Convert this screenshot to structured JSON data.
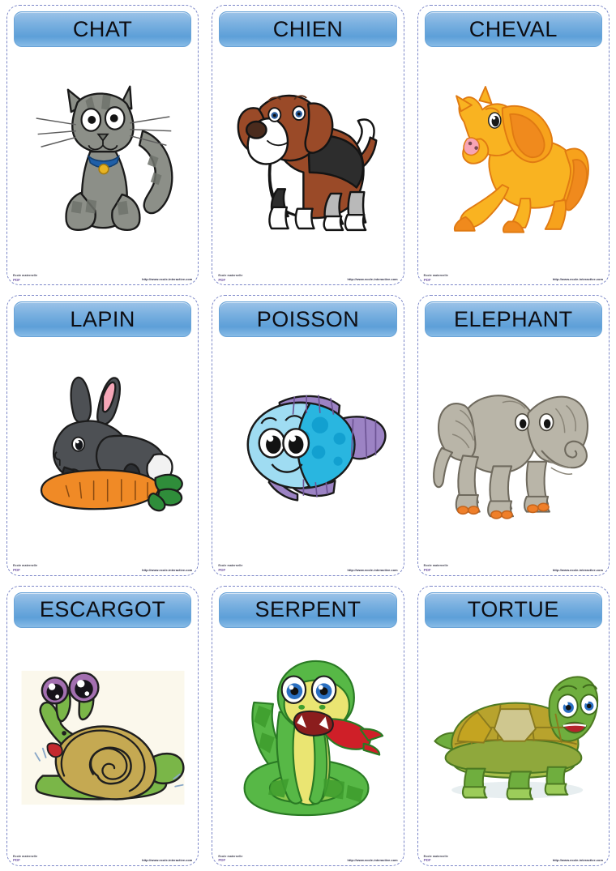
{
  "page": {
    "kind": "flashcard-sheet",
    "columns": 3,
    "rows": 3,
    "background": "#ffffff",
    "card_border_color": "#7b86c8",
    "header_gradient_top": "#9cc3e8",
    "header_gradient_bottom": "#5d9fd8",
    "title_color": "#0d0d12"
  },
  "footer": {
    "brand_name": "Ecole maternelle",
    "brand_sub": "PDF",
    "url": "http://www.ecole-interactive.com"
  },
  "cards": [
    {
      "title": "CHAT",
      "illustration": "cat-illustration",
      "colors": {
        "body": "#8c8f88",
        "shade": "#6f736c",
        "accent": "#1f5fa8",
        "bell": "#e8b423"
      }
    },
    {
      "title": "CHIEN",
      "illustration": "dog-illustration",
      "colors": {
        "body": "#9a4a28",
        "shade": "#2d2d2d",
        "accent": "#ffffff",
        "nose": "#4a2b1d"
      }
    },
    {
      "title": "CHEVAL",
      "illustration": "horse-illustration",
      "colors": {
        "body": "#f9b321",
        "shade": "#f08a1d",
        "accent": "#f7a4b5",
        "eye": "#1b1b1b"
      }
    },
    {
      "title": "LAPIN",
      "illustration": "rabbit-illustration",
      "colors": {
        "body": "#4d5054",
        "shade": "#34373a",
        "accent": "#f6a7b8",
        "carrot": "#f08a26",
        "leaves": "#2f8d3a"
      }
    },
    {
      "title": "POISSON",
      "illustration": "fish-illustration",
      "colors": {
        "body": "#29b6e0",
        "shade": "#9fdcf2",
        "accent": "#9c83c4",
        "spots": "#12a0d0"
      }
    },
    {
      "title": "ELEPHANT",
      "illustration": "elephant-illustration",
      "colors": {
        "body": "#b9b5a8",
        "shade": "#9a968a",
        "accent": "#ef7f2a",
        "eye": "#1b1b1b"
      }
    },
    {
      "title": "ESCARGOT",
      "illustration": "snail-illustration",
      "colors": {
        "body": "#7ab648",
        "shell": "#c5a952",
        "accent": "#a36fb0",
        "mouth": "#c4292f",
        "bg": "#fbf8ec"
      }
    },
    {
      "title": "SERPENT",
      "illustration": "snake-illustration",
      "colors": {
        "body": "#57b846",
        "belly": "#eae572",
        "accent": "#cf1f28",
        "eye": "#2a6fc0"
      }
    },
    {
      "title": "TORTUE",
      "illustration": "turtle-illustration",
      "colors": {
        "body": "#6fae3e",
        "shell": "#b8a32d",
        "shellLight": "#cfc78f",
        "accent": "#2a6fc0"
      }
    }
  ]
}
